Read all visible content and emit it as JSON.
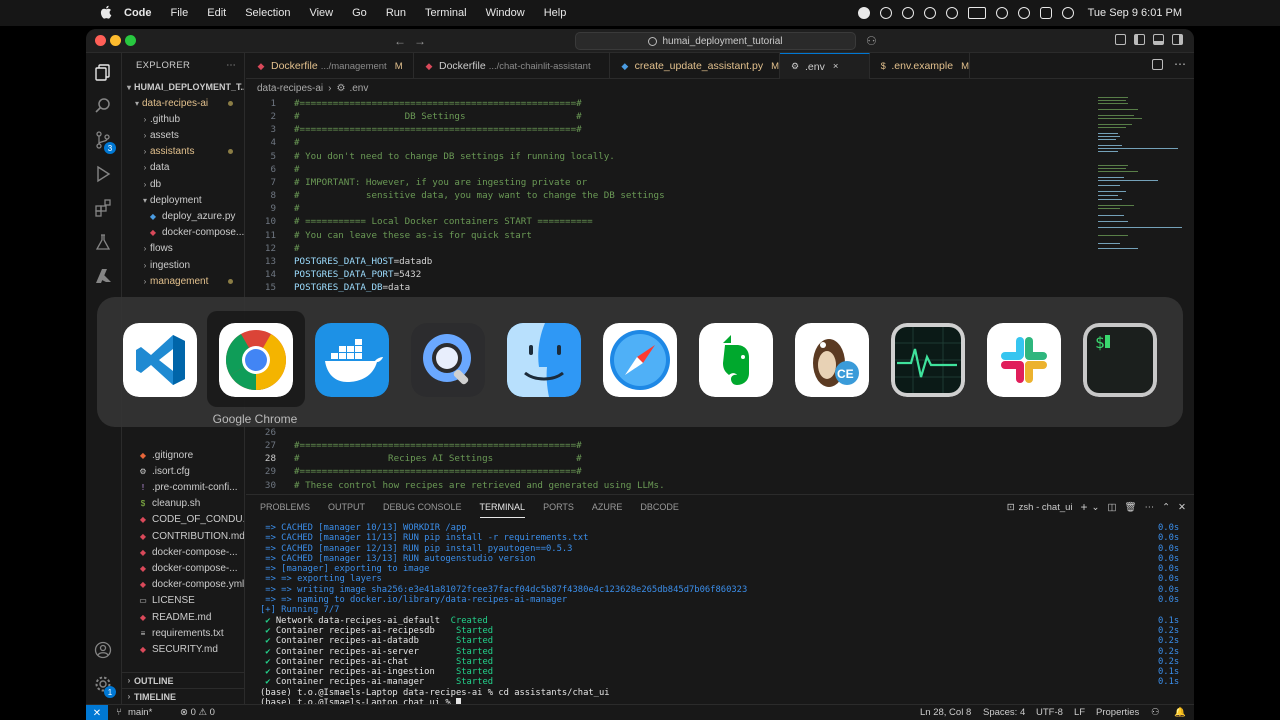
{
  "menubar": {
    "app_name": "Code",
    "items": [
      "File",
      "Edit",
      "Selection",
      "View",
      "Go",
      "Run",
      "Terminal",
      "Window",
      "Help"
    ],
    "clock": "Tue Sep 9  6:01 PM"
  },
  "window": {
    "search_text": "humai_deployment_tutorial"
  },
  "sidebar": {
    "title": "EXPLORER",
    "root": "HUMAI_DEPLOYMENT_T...",
    "items": [
      {
        "label": "data-recipes-ai",
        "kind": "folder-open",
        "color": "#e2c08d",
        "dot": true
      },
      {
        "label": ".github",
        "kind": "folder",
        "color": "#cccccc"
      },
      {
        "label": "assets",
        "kind": "folder",
        "color": "#cccccc"
      },
      {
        "label": "assistants",
        "kind": "folder",
        "color": "#e2c08d",
        "dot": true
      },
      {
        "label": "data",
        "kind": "folder",
        "color": "#cccccc"
      },
      {
        "label": "db",
        "kind": "folder",
        "color": "#cccccc"
      },
      {
        "label": "deployment",
        "kind": "folder-open",
        "color": "#cccccc"
      },
      {
        "label": "deploy_azure.py",
        "kind": "python",
        "color": "#cccccc"
      },
      {
        "label": "docker-compose...",
        "kind": "docker",
        "color": "#cccccc"
      },
      {
        "label": "flows",
        "kind": "folder",
        "color": "#cccccc"
      },
      {
        "label": "ingestion",
        "kind": "folder",
        "color": "#cccccc"
      },
      {
        "label": "management",
        "kind": "folder",
        "color": "#e2c08d",
        "dot": true
      }
    ],
    "lower_items": [
      {
        "label": ".gitignore",
        "kind": "git",
        "color": "#cccccc"
      },
      {
        "label": ".isort.cfg",
        "kind": "gear",
        "color": "#cccccc"
      },
      {
        "label": ".pre-commit-confi...",
        "kind": "yaml",
        "color": "#cccccc"
      },
      {
        "label": "cleanup.sh",
        "kind": "shell",
        "color": "#cccccc"
      },
      {
        "label": "CODE_OF_CONDU...",
        "kind": "md",
        "color": "#cccccc"
      },
      {
        "label": "CONTRIBUTION.md",
        "kind": "md",
        "color": "#cccccc"
      },
      {
        "label": "docker-compose-...",
        "kind": "docker",
        "color": "#cccccc"
      },
      {
        "label": "docker-compose-...",
        "kind": "docker",
        "color": "#cccccc"
      },
      {
        "label": "docker-compose.yml",
        "kind": "docker",
        "color": "#cccccc"
      },
      {
        "label": "LICENSE",
        "kind": "license",
        "color": "#cccccc"
      },
      {
        "label": "README.md",
        "kind": "md",
        "color": "#cccccc"
      },
      {
        "label": "requirements.txt",
        "kind": "txt",
        "color": "#cccccc"
      },
      {
        "label": "SECURITY.md",
        "kind": "md",
        "color": "#cccccc"
      }
    ],
    "outline": "OUTLINE",
    "timeline": "TIMELINE",
    "scm_badge": "3",
    "account_badge": "1"
  },
  "tabs": [
    {
      "name": "Dockerfile",
      "desc": ".../management",
      "mod": "M",
      "icon": "docker",
      "color": "#e2c08d"
    },
    {
      "name": "Dockerfile",
      "desc": ".../chat-chainlit-assistant",
      "mod": "",
      "icon": "docker",
      "color": "#cccccc"
    },
    {
      "name": "create_update_assistant.py",
      "desc": "",
      "mod": "M",
      "icon": "python",
      "color": "#e2c08d"
    },
    {
      "name": ".env",
      "desc": "",
      "mod": "×",
      "icon": "gear",
      "color": "#cccccc",
      "active": true
    },
    {
      "name": ".env.example",
      "desc": "",
      "mod": "M",
      "icon": "dollar",
      "color": "#e2c08d"
    }
  ],
  "breadcrumb": {
    "folder": "data-recipes-ai",
    "file": ".env"
  },
  "code_lines": [
    {
      "n": "1",
      "parts": [
        [
          "c",
          "#==================================================#"
        ]
      ]
    },
    {
      "n": "2",
      "parts": [
        [
          "c",
          "#                   DB Settings                    #"
        ]
      ]
    },
    {
      "n": "3",
      "parts": [
        [
          "c",
          "#==================================================#"
        ]
      ]
    },
    {
      "n": "4",
      "parts": [
        [
          "c",
          "#"
        ]
      ]
    },
    {
      "n": "5",
      "parts": [
        [
          "c",
          "# You don't need to change DB settings if running locally."
        ]
      ]
    },
    {
      "n": "6",
      "parts": [
        [
          "c",
          "#"
        ]
      ]
    },
    {
      "n": "7",
      "parts": [
        [
          "c",
          "# IMPORTANT: However, if you are ingesting private or"
        ]
      ]
    },
    {
      "n": "8",
      "parts": [
        [
          "c",
          "#            sensitive data, you may want to change the DB settings"
        ]
      ]
    },
    {
      "n": "9",
      "parts": [
        [
          "c",
          "#"
        ]
      ]
    },
    {
      "n": "10",
      "parts": [
        [
          "c",
          "# =========== Local Docker containers START =========="
        ]
      ]
    },
    {
      "n": "11",
      "parts": [
        [
          "c",
          "# You can leave these as-is for quick start"
        ]
      ]
    },
    {
      "n": "12",
      "parts": [
        [
          "c",
          "#"
        ]
      ]
    },
    {
      "n": "13",
      "parts": [
        [
          "k",
          "POSTGRES_DATA_HOST"
        ],
        [
          "p",
          "=datadb"
        ]
      ]
    },
    {
      "n": "14",
      "parts": [
        [
          "k",
          "POSTGRES_DATA_PORT"
        ],
        [
          "p",
          "=5432"
        ]
      ]
    },
    {
      "n": "15",
      "parts": [
        [
          "k",
          "POSTGRES_DATA_DB"
        ],
        [
          "p",
          "=data"
        ]
      ]
    }
  ],
  "code_lines_lower": [
    {
      "n": "26",
      "parts": []
    },
    {
      "n": "27",
      "parts": [
        [
          "c",
          "#==================================================#"
        ]
      ]
    },
    {
      "n": "28",
      "parts": [
        [
          "c",
          "#                Recipes AI Settings               #"
        ]
      ],
      "current": true
    },
    {
      "n": "29",
      "parts": [
        [
          "c",
          "#==================================================#"
        ]
      ]
    },
    {
      "n": "30",
      "parts": [
        [
          "c",
          "# These control how recipes are retrieved and generated using LLMs."
        ]
      ]
    }
  ],
  "panel": {
    "tabs": [
      "PROBLEMS",
      "OUTPUT",
      "DEBUG CONSOLE",
      "TERMINAL",
      "PORTS",
      "AZURE",
      "DBCODE"
    ],
    "active_tab": "TERMINAL",
    "terminal_name": "zsh - chat_ui"
  },
  "terminal_lines": [
    {
      "text": " => CACHED [manager 10/13] WORKDIR /app",
      "cls": "t-blue",
      "time": "0.0s"
    },
    {
      "text": " => CACHED [manager 11/13] RUN pip install -r requirements.txt",
      "cls": "t-blue",
      "time": "0.0s"
    },
    {
      "text": " => CACHED [manager 12/13] RUN pip install pyautogen==0.5.3",
      "cls": "t-blue",
      "time": "0.0s"
    },
    {
      "text": " => CACHED [manager 13/13] RUN autogenstudio version",
      "cls": "t-blue",
      "time": "0.0s"
    },
    {
      "text": " => [manager] exporting to image",
      "cls": "t-blue",
      "time": "0.0s"
    },
    {
      "text": " => => exporting layers",
      "cls": "t-blue",
      "time": "0.0s"
    },
    {
      "text": " => => writing image sha256:e3e41a81072fcee37facf04dc5b87f4380e4c123628e265db845d7b06f860323",
      "cls": "t-blue",
      "time": "0.0s"
    },
    {
      "text": " => => naming to docker.io/library/data-recipes-ai-manager",
      "cls": "t-blue",
      "time": "0.0s"
    },
    {
      "text": "[+] Running 7/7",
      "cls": "t-blue",
      "time": ""
    },
    {
      "check": " ✔ ",
      "name": "Network data-recipes-ai_default  ",
      "status": "Created",
      "time": "0.1s"
    },
    {
      "check": " ✔ ",
      "name": "Container recipes-ai-recipesdb    ",
      "status": "Started",
      "time": "0.2s"
    },
    {
      "check": " ✔ ",
      "name": "Container recipes-ai-datadb       ",
      "status": "Started",
      "time": "0.2s"
    },
    {
      "check": " ✔ ",
      "name": "Container recipes-ai-server       ",
      "status": "Started",
      "time": "0.2s"
    },
    {
      "check": " ✔ ",
      "name": "Container recipes-ai-chat         ",
      "status": "Started",
      "time": "0.2s"
    },
    {
      "check": " ✔ ",
      "name": "Container recipes-ai-ingestion    ",
      "status": "Started",
      "time": "0.1s"
    },
    {
      "check": " ✔ ",
      "name": "Container recipes-ai-manager      ",
      "status": "Started",
      "time": "0.1s"
    },
    {
      "text": "(base) t.o.@Ismaels-Laptop data-recipes-ai % cd assistants/chat_ui",
      "cls": "t-white",
      "time": ""
    },
    {
      "text": "(base) t.o.@Ismaels-Laptop chat_ui % ",
      "cls": "t-white",
      "time": "",
      "cursor": true
    }
  ],
  "statusbar": {
    "branch": "main*",
    "problems": "⊗ 0 ⚠ 0",
    "position": "Ln 28, Col 8",
    "spaces": "Spaces: 4",
    "encoding": "UTF-8",
    "eol": "LF",
    "language": "Properties"
  },
  "switcher": {
    "apps": [
      "vscode",
      "chrome",
      "docker",
      "quicktime",
      "finder",
      "safari",
      "evernote",
      "dbeaver",
      "activity-monitor",
      "slack",
      "terminal"
    ],
    "selected_label": "Google Chrome",
    "dbeaver_badge": "CE",
    "terminal_prompt": "$"
  },
  "colors": {
    "accent": "#0078d4",
    "comment": "#6a9955",
    "modified": "#e2c08d",
    "terminal_blue": "#3b8eea",
    "terminal_green": "#23d18b"
  }
}
